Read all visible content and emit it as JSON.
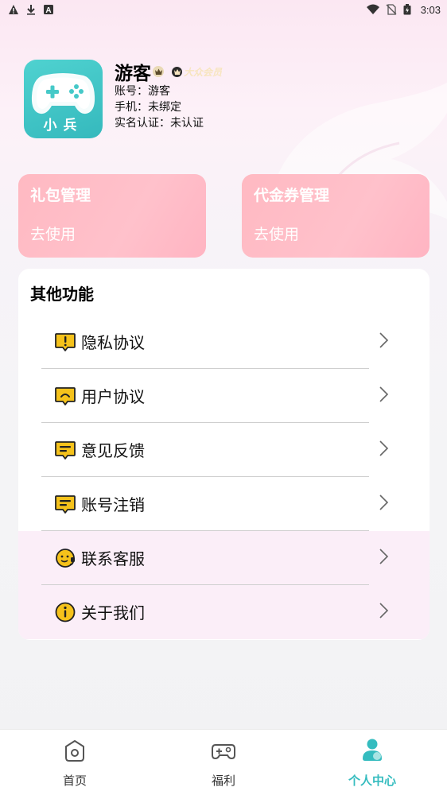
{
  "status_bar": {
    "left_icons": [
      "warning-icon",
      "download-icon",
      "a-badge-icon"
    ],
    "right_icons": [
      "wifi-icon",
      "no-sim-icon",
      "battery-icon"
    ],
    "time": "3:03"
  },
  "profile": {
    "logo_text": "小兵",
    "username": "游客",
    "member_label": "大众会员",
    "account": "账号：游客",
    "phone": "手机：未绑定",
    "realname": "实名认证：未认证"
  },
  "cards": [
    {
      "title": "礼包管理",
      "action": "去使用"
    },
    {
      "title": "代金券管理",
      "action": "去使用"
    }
  ],
  "other_functions": {
    "title": "其他功能",
    "items": [
      {
        "label": "隐私协议",
        "icon": "privacy-icon"
      },
      {
        "label": "用户协议",
        "icon": "user-agreement-icon"
      },
      {
        "label": "意见反馈",
        "icon": "feedback-icon"
      },
      {
        "label": "账号注销",
        "icon": "account-cancel-icon"
      },
      {
        "label": "联系客服",
        "icon": "customer-service-icon"
      },
      {
        "label": "关于我们",
        "icon": "info-icon"
      }
    ]
  },
  "bottom_nav": {
    "items": [
      {
        "label": "首页",
        "icon": "home-icon"
      },
      {
        "label": "福利",
        "icon": "gamepad-icon"
      },
      {
        "label": "个人中心",
        "icon": "person-icon"
      }
    ],
    "active_index": 2,
    "accent_color": "#35bcbf"
  }
}
